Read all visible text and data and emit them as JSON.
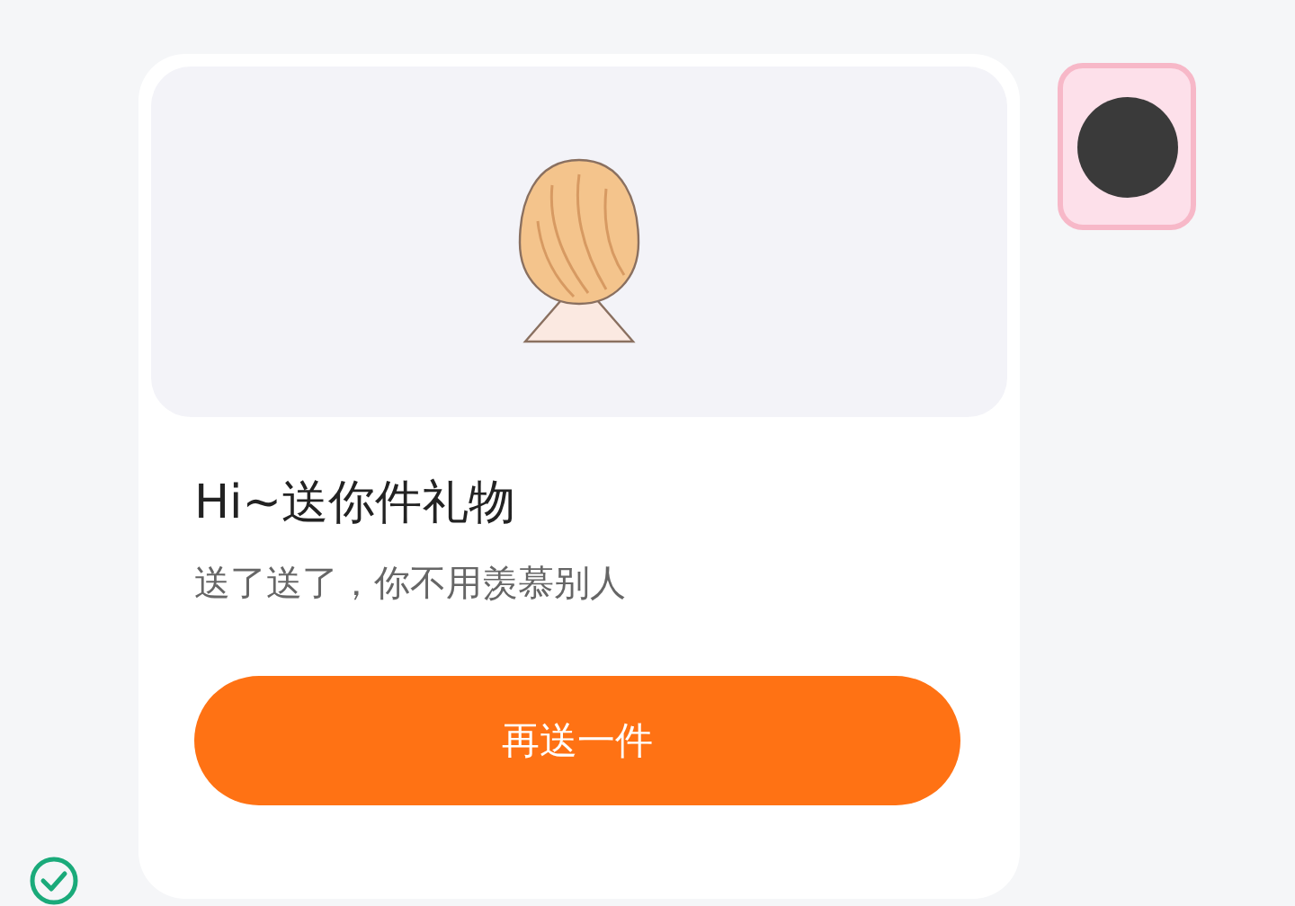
{
  "title": "Hi~送你件礼物",
  "message": "送了送了，你不用羡慕别人",
  "button": {
    "label": "再送一件"
  },
  "sent": true
}
